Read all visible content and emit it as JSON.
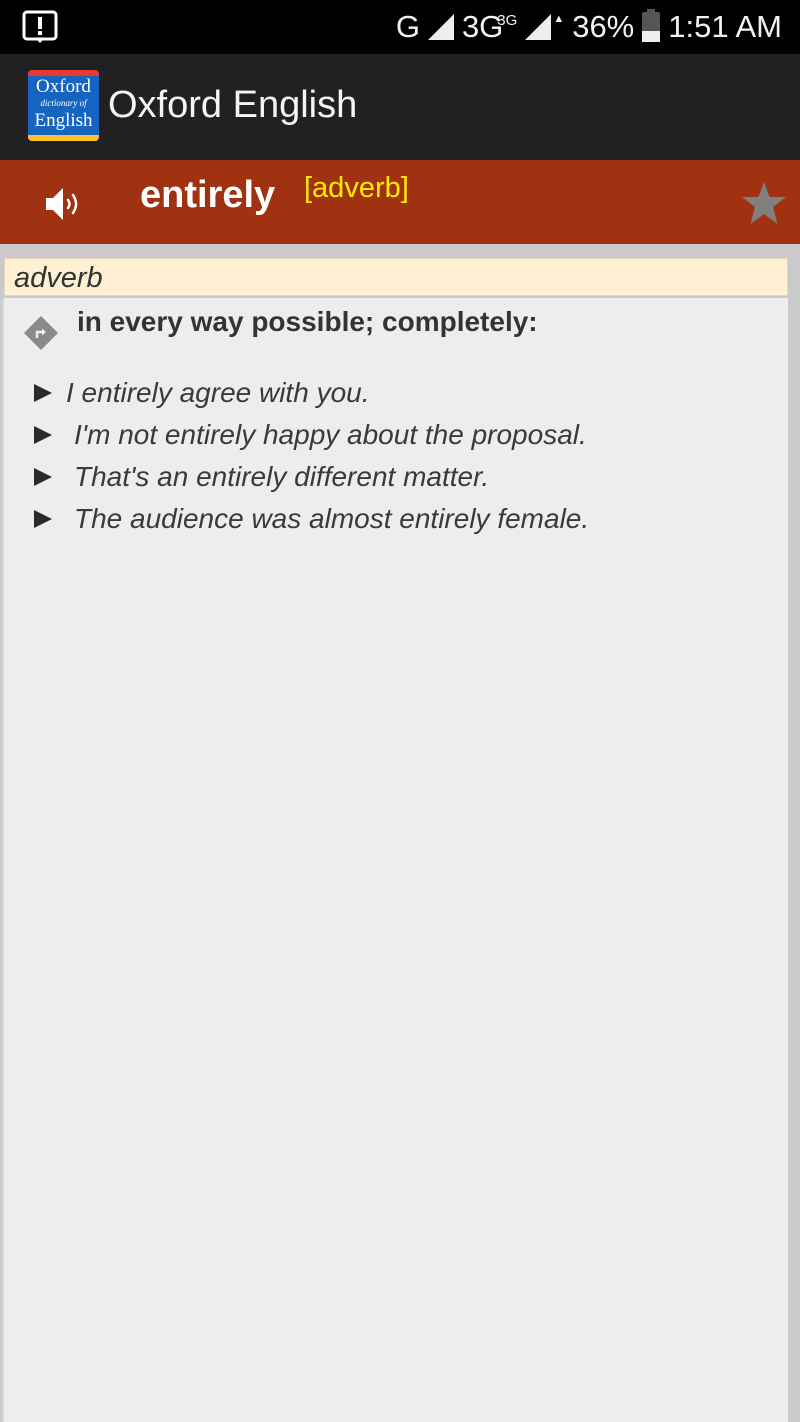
{
  "status_bar": {
    "notification_icon": "alert-notification-icon",
    "network_1": "G",
    "network_2": "3G",
    "network_2_sup": "3G",
    "battery_percent": "36%",
    "battery_level": 0.36,
    "time": "1:51 AM"
  },
  "app_bar": {
    "logo": {
      "line1": "Oxford",
      "line2": "dictionary of",
      "line3": "English"
    },
    "title": "Oxford English"
  },
  "entry": {
    "word": "entirely",
    "part_of_speech_tag": "[adverb]",
    "speaker_icon": "speaker-icon",
    "favorite_icon": "star-icon",
    "colors": {
      "word_bar": "#a13211",
      "pos_tag": "#ffeb00",
      "star": "#808080"
    }
  },
  "definition_block": {
    "part_of_speech": "adverb",
    "definition": "in every way possible; completely:",
    "examples": [
      "I entirely agree with you.",
      "I'm not entirely happy about the proposal.",
      "That's an entirely different matter.",
      "The audience was almost entirely female."
    ]
  }
}
